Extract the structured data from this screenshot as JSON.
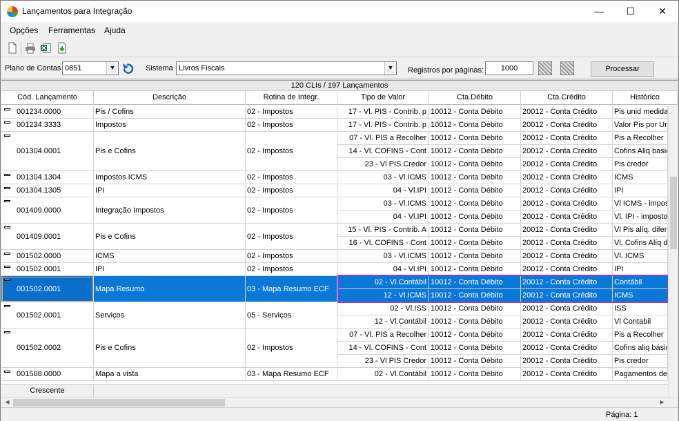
{
  "window": {
    "title": "Lançamentos para Integração"
  },
  "menu": [
    "Opções",
    "Ferramentas",
    "Ajuda"
  ],
  "filters": {
    "plano_label": "Plano de Contas",
    "plano_value": "0851",
    "sistema_label": "Sistema",
    "sistema_value": "Livros Fiscais",
    "registros_label": "Registros por páginas:",
    "registros_value": "1000",
    "processar_label": "Processar"
  },
  "grid": {
    "summary": "120 CLIs / 197 Lançamentos",
    "columns": [
      "Cód. Lançamento",
      "Descrição",
      "Rotina de Integr.",
      "Tipo de Valor",
      "Cta.Débito",
      "Cta.Crédito",
      "Histórico"
    ],
    "groups": [
      {
        "code": "001234.0000",
        "desc": "Pis / Cofins",
        "rotina": "02 - Impostos",
        "lines": [
          [
            "17 - Vl. PIS - Contrib. p",
            "10012 - Conta Débito",
            "20012 - Conta Crédito",
            "Pis unid medida"
          ]
        ]
      },
      {
        "code": "001234.3333",
        "desc": "Impostos",
        "rotina": "02 - Impostos",
        "lines": [
          [
            "17 - Vl. PIS - Contrib. p",
            "10012 - Conta Débito",
            "20012 - Conta Crédito",
            "Valor Pis por Uni"
          ]
        ]
      },
      {
        "code": "001304.0001",
        "desc": "Pis e Cofins",
        "rotina": "02 - Impostos",
        "lines": [
          [
            "07 - Vl. PIS a Recolher",
            "10012 - Conta Débito",
            "20012 - Conta Crédito",
            "Pis a Recolher"
          ],
          [
            "14 - Vl. COFINS - Cont",
            "10012 - Conta Débito",
            "20012 - Conta Crédito",
            "Cofins Aliq basic"
          ],
          [
            "23 - Vl PIS Credor",
            "10012 - Conta Débito",
            "20012 - Conta Crédito",
            "Pis credor"
          ]
        ]
      },
      {
        "code": "001304.1304",
        "desc": "Impostos ICMS",
        "rotina": "02 - Impostos",
        "lines": [
          [
            "03 - Vl.ICMS",
            "10012 - Conta Débito",
            "20012 - Conta Crédito",
            "ICMS"
          ]
        ]
      },
      {
        "code": "001304.1305",
        "desc": "IPI",
        "rotina": "02 - Impostos",
        "lines": [
          [
            "04 - Vl.IPI",
            "10012 - Conta Débito",
            "20012 - Conta Crédito",
            "IPI"
          ]
        ]
      },
      {
        "code": "001409.0000",
        "desc": "Integração Impostos",
        "rotina": "02 - Impostos",
        "lines": [
          [
            "03 - Vl.ICMS",
            "10012 - Conta Débito",
            "20012 - Conta Crédito",
            "Vl ICMS - impos"
          ],
          [
            "04 - Vl.IPI",
            "10012 - Conta Débito",
            "20012 - Conta Crédito",
            "Vl. IPI - impostos"
          ]
        ]
      },
      {
        "code": "001409.0001",
        "desc": "Pis e Cofins",
        "rotina": "02 - Impostos",
        "lines": [
          [
            "15 - Vl. PIS - Contrib. A",
            "10012 - Conta Débito",
            "20012 - Conta Crédito",
            "Vl Pis alíq. difere"
          ],
          [
            "16 - Vl. COFINS - Cont",
            "10012 - Conta Débito",
            "20012 - Conta Crédito",
            "Vl. Cofins Alíq di"
          ]
        ]
      },
      {
        "code": "001502.0000",
        "desc": "ICMS",
        "rotina": "02 - Impostos",
        "lines": [
          [
            "03 - Vl.ICMS",
            "10012 - Conta Débito",
            "20012 - Conta Crédito",
            "Vl. ICMS"
          ]
        ]
      },
      {
        "code": "001502.0001",
        "desc": "IPI",
        "rotina": "02 - Impostos",
        "lines": [
          [
            "04 - Vl.IPI",
            "10012 - Conta Débito",
            "20012 - Conta Crédito",
            "IPI"
          ]
        ]
      },
      {
        "code": "001502.0001",
        "desc": "Mapa Resumo",
        "rotina": "03 - Mapa Resumo ECF",
        "selected": true,
        "lines": [
          [
            "02 - Vl.Contábil",
            "10012 - Conta Débito",
            "20012 - Conta Crédito",
            "Contábil"
          ],
          [
            "12 - Vl.ICMS",
            "10012 - Conta Débito",
            "20012 - Conta Crédito",
            "ICMS"
          ]
        ]
      },
      {
        "code": "001502.0001",
        "desc": "Serviços",
        "rotina": "05 - Serviços",
        "lines": [
          [
            "02 - Vl.ISS",
            "10012 - Conta Débito",
            "20012 - Conta Crédito",
            "ISS"
          ],
          [
            "12 - Vl.Contábil",
            "10012 - Conta Débito",
            "20012 - Conta Crédito",
            "Vl Contabil"
          ]
        ]
      },
      {
        "code": "001502.0002",
        "desc": "Pis e Cofins",
        "rotina": "02 - Impostos",
        "lines": [
          [
            "07 - Vl. PIS a Recolher",
            "10012 - Conta Débito",
            "20012 - Conta Crédito",
            "Pis a Recolher"
          ],
          [
            "14 - Vl. COFINS - Cont",
            "10012 - Conta Débito",
            "20012 - Conta Crédito",
            "Cofins aliq básica"
          ],
          [
            "23 - Vl PIS Credor",
            "10012 - Conta Débito",
            "20012 - Conta Crédito",
            "Pis credor"
          ]
        ]
      },
      {
        "code": "001508.0000",
        "desc": "Mapa a vista",
        "rotina": "03 - Mapa Resumo ECF",
        "lines": [
          [
            "02 - Vl.Contábil",
            "10012 - Conta Débito",
            "20012 - Conta Crédito",
            "Pagamentos de"
          ]
        ]
      }
    ],
    "footer_sort": "Crescente"
  },
  "status": {
    "page": "Página: 1"
  }
}
